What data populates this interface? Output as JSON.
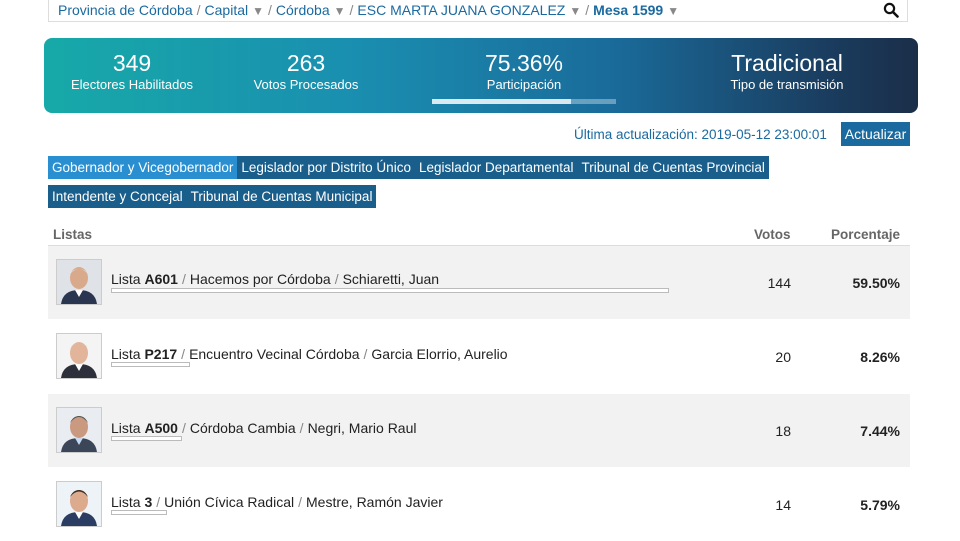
{
  "breadcrumb": {
    "items": [
      "Provincia de Córdoba",
      "Capital",
      "Córdoba",
      "ESC MARTA JUANA GONZALEZ",
      "Mesa 1599"
    ],
    "separator": "/",
    "dropdown_glyph": "▼"
  },
  "banner": {
    "electores_value": "349",
    "electores_label": "Electores Habilitados",
    "votos_value": "263",
    "votos_label": "Votos Procesados",
    "participacion_value": "75.36%",
    "participacion_label": "Participación",
    "participacion_fraction": 0.7536,
    "transmision_value": "Tradicional",
    "transmision_label": "Tipo de transmisión"
  },
  "update": {
    "text": "Última actualización: 2019-05-12 23:00:01",
    "button": "Actualizar"
  },
  "tabs": {
    "row1": [
      "Gobernador y Vicegobernador",
      "Legislador por Distrito Único",
      "Legislador Departamental",
      "Tribunal de Cuentas Provincial"
    ],
    "row2": [
      "Intendente y Concejal",
      "Tribunal de Cuentas Municipal"
    ],
    "active": "Gobernador y Vicegobernador"
  },
  "table": {
    "headers": {
      "listas": "Listas",
      "votos": "Votos",
      "porcentaje": "Porcentaje"
    },
    "rows": [
      {
        "prefix": "Lista",
        "code": "A601",
        "party": "Hacemos por Córdoba",
        "candidate": "Schiaretti, Juan",
        "votes": "144",
        "percent": "59.50%",
        "share": 0.595
      },
      {
        "prefix": "Lista",
        "code": "P217",
        "party": "Encuentro Vecinal Córdoba",
        "candidate": "Garcia Elorrio, Aurelio",
        "votes": "20",
        "percent": "8.26%",
        "share": 0.0826
      },
      {
        "prefix": "Lista",
        "code": "A500",
        "party": "Córdoba Cambia",
        "candidate": "Negri, Mario Raul",
        "votes": "18",
        "percent": "7.44%",
        "share": 0.0744
      },
      {
        "prefix": "Lista",
        "code": "3",
        "party": "Unión Cívica Radical",
        "candidate": "Mestre, Ramón Javier",
        "votes": "14",
        "percent": "5.79%",
        "share": 0.0579
      }
    ]
  },
  "icons": {
    "search": "search-icon",
    "dropdown": "chevron-down-icon",
    "avatar": "candidate-photo"
  },
  "colors": {
    "link": "#1a6aa0",
    "tab": "#1a5f8c",
    "tab_active": "#2a8fd0",
    "banner_start": "#17a9a8",
    "banner_end": "#1b2e48"
  }
}
